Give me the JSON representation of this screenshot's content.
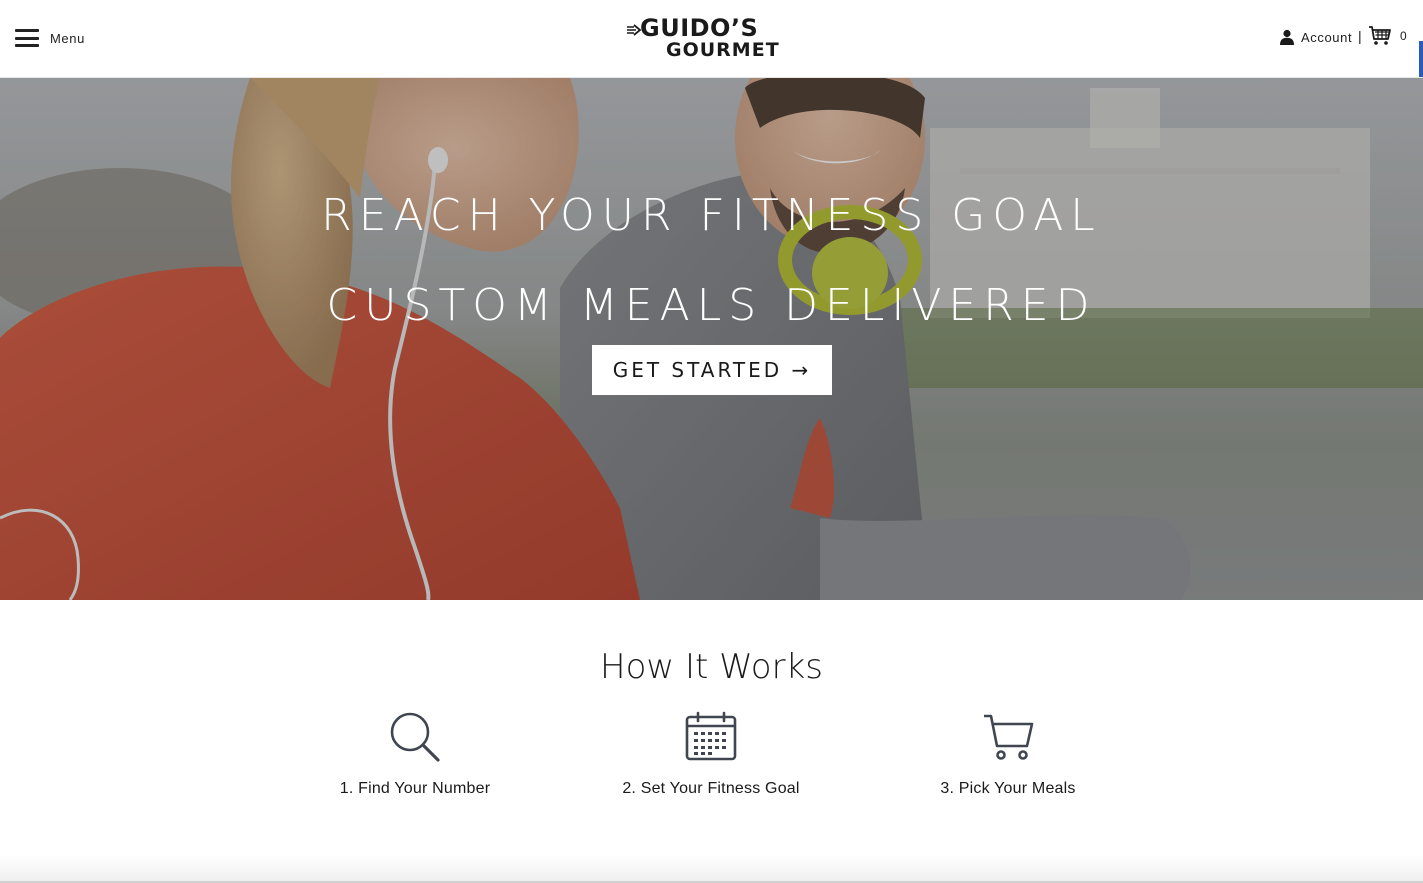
{
  "header": {
    "menu_label": "Menu",
    "logo_line1": "GUIDO’S",
    "logo_line2": "GOURMET",
    "account_label": "Account",
    "separator": "|",
    "cart_count": "0"
  },
  "hero": {
    "title_line1": "REACH YOUR FITNESS GOAL",
    "title_line2": "CUSTOM MEALS DELIVERED",
    "cta_label": "GET STARTED →"
  },
  "how_it_works": {
    "title": "How It Works",
    "steps": [
      {
        "icon": "search-icon",
        "label": "1. Find Your Number"
      },
      {
        "icon": "calendar-icon",
        "label": "2. Set Your Fitness Goal"
      },
      {
        "icon": "cart-icon",
        "label": "3. Pick Your Meals"
      }
    ]
  },
  "colors": {
    "accent_edge": "#2a5cb8",
    "text": "#1a1a1a",
    "icon_stroke": "#3f4650"
  }
}
